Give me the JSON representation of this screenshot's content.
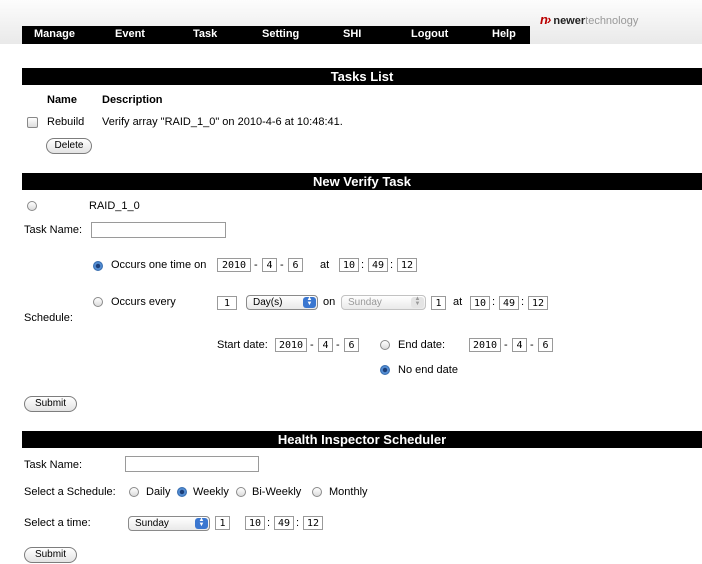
{
  "nav": [
    "Manage",
    "Event",
    "Task",
    "Setting",
    "SHI",
    "Logout",
    "Help"
  ],
  "logo": {
    "mark": "n›",
    "brand_bold": "newer",
    "brand_rest": "technology"
  },
  "tasks_list": {
    "title": "Tasks List",
    "col_name": "Name",
    "col_desc": "Description",
    "row": {
      "name": "Rebuild",
      "desc": "Verify array \"RAID_1_0\" on 2010-4-6 at 10:48:41."
    },
    "delete": "Delete"
  },
  "verify": {
    "title": "New Verify Task",
    "array": "RAID_1_0",
    "task_name_label": "Task Name:",
    "task_name_value": "",
    "schedule_label": "Schedule:",
    "once_label": "Occurs one time on",
    "once": {
      "y": "2010",
      "m": "4",
      "d": "6",
      "h": "10",
      "mi": "49",
      "s": "12"
    },
    "every_label": "Occurs every",
    "every_n": "1",
    "every_unit": "Day(s)",
    "on_label": "on",
    "on_day": "Sunday",
    "on_n": "1",
    "at_label": "at",
    "every_time": {
      "h": "10",
      "mi": "49",
      "s": "12"
    },
    "start_label": "Start date:",
    "start": {
      "y": "2010",
      "m": "4",
      "d": "6"
    },
    "end_label": "End date:",
    "end": {
      "y": "2010",
      "m": "4",
      "d": "6"
    },
    "no_end_label": "No end date",
    "dash": "-",
    "colon": ":",
    "submit": "Submit"
  },
  "health": {
    "title": "Health Inspector Scheduler",
    "task_name_label": "Task Name:",
    "task_name_value": "",
    "schedule_label": "Select a Schedule:",
    "options": [
      "Daily",
      "Weekly",
      "Bi-Weekly",
      "Monthly"
    ],
    "selected": "Weekly",
    "time_label": "Select a time:",
    "day": "Sunday",
    "n": "1",
    "time": {
      "h": "10",
      "mi": "49",
      "s": "12"
    },
    "submit": "Submit"
  }
}
